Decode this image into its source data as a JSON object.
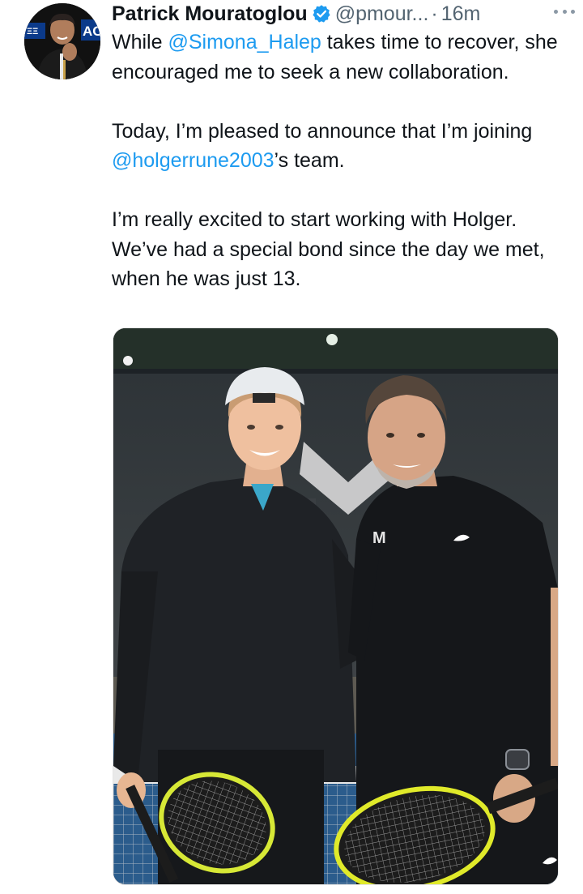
{
  "tweet": {
    "author": {
      "display_name": "Patrick Mouratoglou",
      "verified": true,
      "handle": "@pmour...",
      "avatar": "profile-photo"
    },
    "separator": "·",
    "timestamp": "16m",
    "more_icon": "more-options-icon",
    "text": {
      "p1_before": "While ",
      "p1_mention": "@Simona_Halep",
      "p1_after": " takes time to recover, she encouraged me to seek a new collaboration.",
      "p2_before": "Today, I’m pleased to announce that I’m joining ",
      "p2_mention": "@holgerrune2003",
      "p2_after": "’s team.",
      "p3": "I’m really excited to start working with Holger. We’ve had a special bond since the day we met, when he was just 13."
    },
    "media": {
      "type": "photo"
    }
  },
  "colors": {
    "mention": "#1d9bf0",
    "verified": "#1d9bf0",
    "secondary_text": "#536471",
    "primary_text": "#0f1419"
  }
}
